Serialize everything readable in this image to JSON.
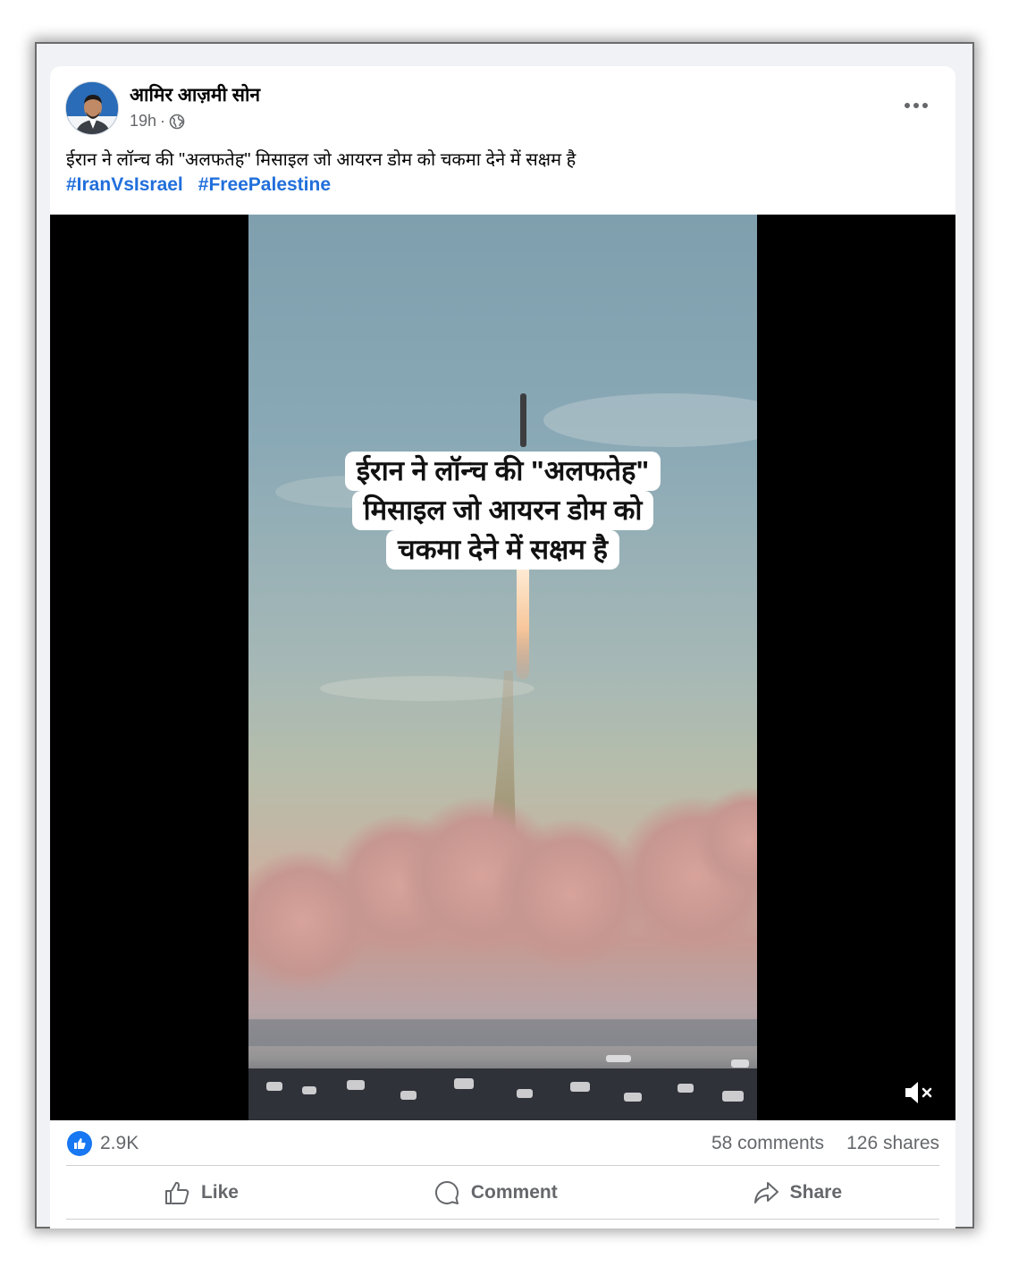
{
  "post": {
    "author": "आमिर आज़मी सोन",
    "time": "19h",
    "separator": "·",
    "caption": "ईरान ने लॉन्च की \"अलफतेह\" मिसाइल जो आयरन डोम को चकमा देने में सक्षम है",
    "hashtags": [
      "#IranVsIsrael",
      "#FreePalestine"
    ]
  },
  "video": {
    "overlay_lines": [
      "ईरान ने लॉन्च की \"अलफतेह\"",
      "मिसाइल जो आयरन डोम को",
      "चकमा देने में सक्षम है"
    ]
  },
  "stats": {
    "likes": "2.9K",
    "comments": "58 comments",
    "shares": "126 shares"
  },
  "actions": {
    "like": "Like",
    "comment": "Comment",
    "share": "Share"
  },
  "icons": {
    "menu": "more-options-icon",
    "privacy": "globe-icon",
    "mute": "muted-speaker-icon",
    "like_badge": "thumbs-up-icon"
  },
  "colors": {
    "link": "#216fdb",
    "like_badge": "#1877f2",
    "muted_text": "#65676b"
  }
}
